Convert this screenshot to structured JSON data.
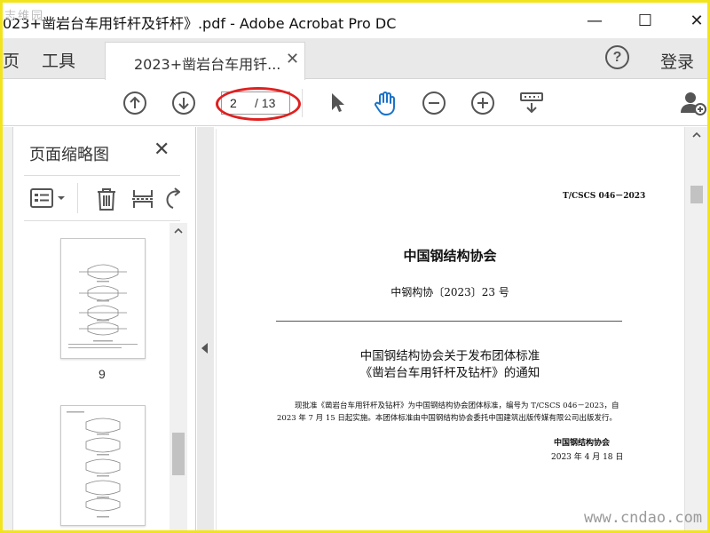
{
  "window": {
    "title": "023+凿岩台车用钎杆及钎杆》.pdf - Adobe Acrobat Pro DC",
    "controls": {
      "minimize": "—",
      "maximize": "☐",
      "close": "✕"
    }
  },
  "watermark_top": "志维园",
  "tabs": {
    "home_partial": "页",
    "tools": "工具",
    "document": "2023+凿岩台车用钎...",
    "close": "✕"
  },
  "header": {
    "help": "?",
    "login": "登录"
  },
  "toolbar": {
    "current_page": "2",
    "total_pages": "/ 13"
  },
  "thumbnail_panel": {
    "title": "页面缩略图",
    "close": "✕",
    "thumbnails": [
      {
        "label": "9"
      },
      {
        "label": ""
      }
    ]
  },
  "document": {
    "code": "T/CSCS 046－2023",
    "org": "中国钢结构协会",
    "doc_number": "中钢构协〔2023〕23 号",
    "heading_line1": "中国钢结构协会关于发布团体标准",
    "heading_line2": "《凿岩台车用钎杆及钻杆》的通知",
    "body_line1": "现批准《凿岩台车用钎杆及钻杆》为中国钢结构协会团体标准，编号为 T/CSCS 046－2023，自",
    "body_line2": "2023 年 7 月 15 日起实施。本团体标准由中国钢结构协会委托中国建筑出版传媒有限公司出版发行。",
    "signature": "中国钢结构协会",
    "date": "2023 年 4 月 18 日"
  },
  "watermark": "www.cndao.com",
  "colors": {
    "highlight": "#e02020",
    "accent": "#1a73c9",
    "frame": "#f2e41c"
  }
}
